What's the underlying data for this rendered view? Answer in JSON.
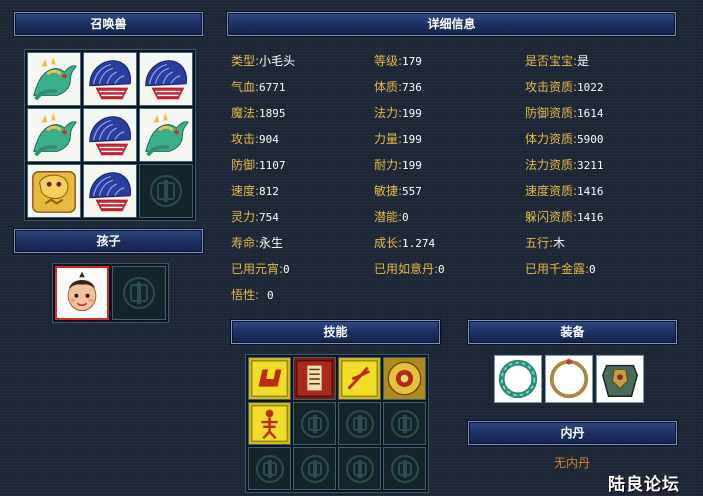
{
  "panels": {
    "summon_title": "召唤兽",
    "child_title": "孩子",
    "details_title": "详细信息",
    "skills_title": "技能",
    "equipment_title": "装备",
    "neidan_title": "内丹"
  },
  "stats": {
    "col1": [
      {
        "label": "类型:",
        "value": "小毛头"
      },
      {
        "label": "气血:",
        "value": "6771"
      },
      {
        "label": "魔法:",
        "value": "1895"
      },
      {
        "label": "攻击:",
        "value": "904"
      },
      {
        "label": "防御:",
        "value": "1107"
      },
      {
        "label": "速度:",
        "value": "812"
      },
      {
        "label": "灵力:",
        "value": "754"
      },
      {
        "label": "寿命:",
        "value": "永生"
      },
      {
        "label": "已用元宵:",
        "value": "0"
      },
      {
        "label": "悟性:",
        "value": "0"
      }
    ],
    "col2": [
      {
        "label": "等级:",
        "value": "179"
      },
      {
        "label": "体质:",
        "value": "736"
      },
      {
        "label": "法力:",
        "value": "199"
      },
      {
        "label": "力量:",
        "value": "199"
      },
      {
        "label": "耐力:",
        "value": "199"
      },
      {
        "label": "敏捷:",
        "value": "557"
      },
      {
        "label": "潜能:",
        "value": "0"
      },
      {
        "label": "成长:",
        "value": "1.274"
      },
      {
        "label": "已用如意丹:",
        "value": "0"
      }
    ],
    "col3": [
      {
        "label": "是否宝宝:",
        "value": "是"
      },
      {
        "label": "攻击资质:",
        "value": "1022"
      },
      {
        "label": "防御资质:",
        "value": "1614"
      },
      {
        "label": "体力资质:",
        "value": "5900"
      },
      {
        "label": "法力资质:",
        "value": "3211"
      },
      {
        "label": "速度资质:",
        "value": "1416"
      },
      {
        "label": "躲闪资质:",
        "value": "1416"
      },
      {
        "label": "五行:",
        "value": "木"
      },
      {
        "label": "已用千金露:",
        "value": "0"
      }
    ]
  },
  "neidan_empty_text": "无内丹",
  "watermark": "陆良论坛",
  "colors": {
    "label": "#e6b84a",
    "value": "#ffffff",
    "header": "#1b2f60",
    "neidan_text": "#d9832e"
  },
  "summons": [
    "dragon-icon",
    "fan-icon",
    "fan-icon",
    "dragon-icon",
    "fan-icon",
    "dragon-icon",
    "golden-beast-icon",
    "fan-icon",
    "empty-slot"
  ],
  "child_slots": [
    "child-portrait",
    "empty-slot"
  ],
  "skills": [
    "skill-icon",
    "skill-icon",
    "skill-icon",
    "skill-icon",
    "skill-icon",
    "empty-slot",
    "empty-slot",
    "empty-slot",
    "empty-slot",
    "empty-slot",
    "empty-slot",
    "empty-slot"
  ],
  "equipment": [
    "collar-icon",
    "ring-icon",
    "armor-icon"
  ]
}
